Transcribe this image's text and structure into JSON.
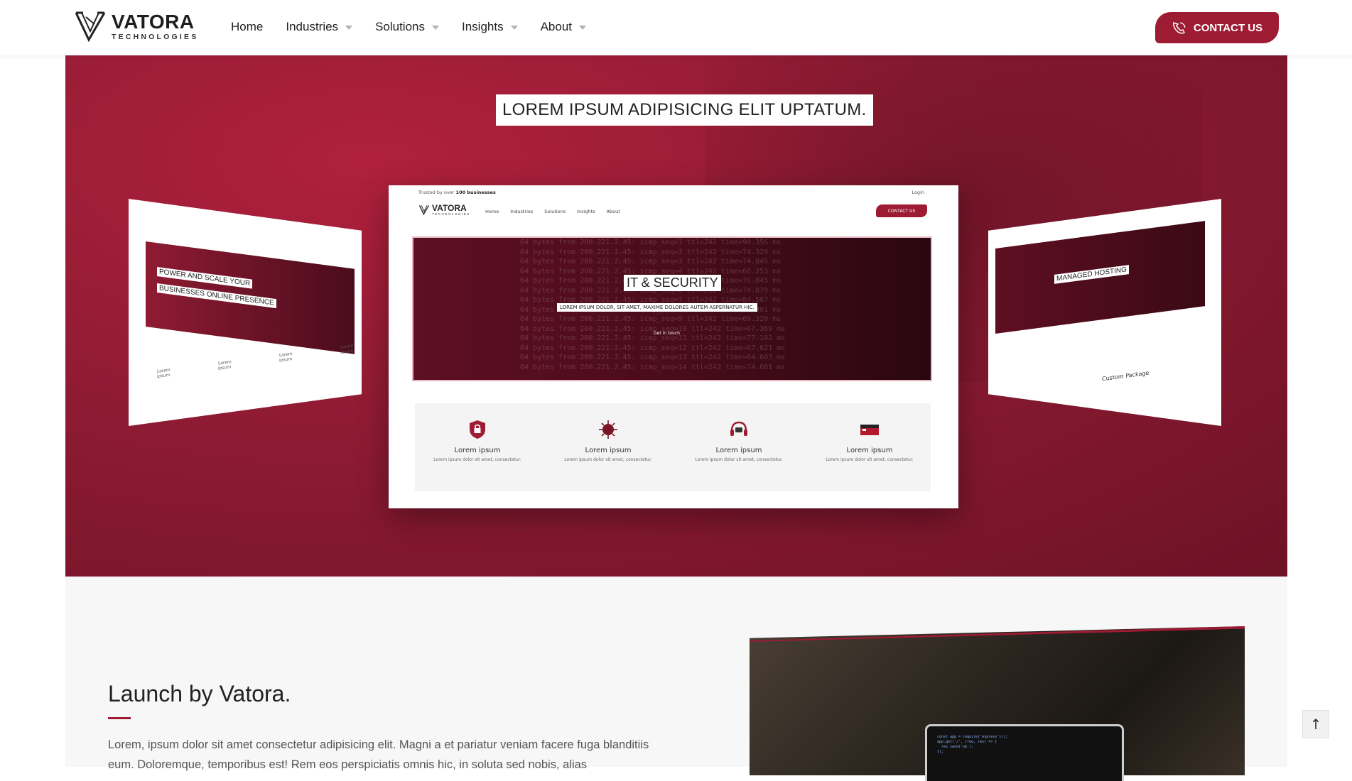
{
  "brand": {
    "name": "VATORA",
    "sub": "TECHNOLOGIES"
  },
  "nav": {
    "items": [
      {
        "label": "Home",
        "dropdown": false
      },
      {
        "label": "Industries",
        "dropdown": true
      },
      {
        "label": "Solutions",
        "dropdown": true
      },
      {
        "label": "Insights",
        "dropdown": true
      },
      {
        "label": "About",
        "dropdown": true
      }
    ],
    "contact_label": "CONTACT US"
  },
  "hero": {
    "title": "LOREM IPSUM ADIPISICING ELIT UPTATUM.",
    "center_mockup": {
      "trusted_prefix": "Trusted by over",
      "trusted_bold": "100 businesses",
      "login": "Login",
      "brand": "VATORA",
      "brand_sub": "TECHNOLOGIES",
      "menu": [
        "Home",
        "Industries",
        "Solutions",
        "Insights",
        "About"
      ],
      "contact": "CONTACT US",
      "banner_title": "IT & SECURITY",
      "banner_sub": "LOREM IPSUM DOLOR, SIT AMET, MAXIME DOLORES AUTEM ASPERNATUR HIC.",
      "banner_btn": "Get in touch",
      "features": [
        {
          "title": "Lorem ipsum",
          "desc": "Lorem ipsum dolor sit amet, consectetur.",
          "icon": "shield-lock-icon"
        },
        {
          "title": "Lorem ipsum",
          "desc": "Lorem ipsum dolor sit amet, consectetur.",
          "icon": "virus-icon"
        },
        {
          "title": "Lorem ipsum",
          "desc": "Lorem ipsum dolor sit amet, consectetur.",
          "icon": "headset-icon"
        },
        {
          "title": "Lorem ipsum",
          "desc": "Lorem ipsum dolor sit amet, consectetur.",
          "icon": "flag-icon"
        }
      ]
    },
    "left_mockup": {
      "title_line1": "POWER AND SCALE YOUR",
      "title_line2": "BUSINESSES ONLINE PRESENCE",
      "feature_labels": [
        "Lorem ipsum",
        "Lorem ipsum",
        "Lorem ipsum",
        "Lorem ipsum"
      ]
    },
    "right_mockup": {
      "title": "MANAGED HOSTING",
      "package": "Custom Package"
    }
  },
  "section": {
    "title": "Launch by Vatora.",
    "text": "Lorem, ipsum dolor sit amet consectetur adipisicing elit. Magni a et pariatur veniam facere fuga blanditiis eum. Doloremque, temporibus est! Rem eos perspiciatis omnis hic, in soluta sed nobis, alias"
  },
  "back_to_top": "↑",
  "colors": {
    "accent": "#9e1b34",
    "hero_dark": "#6d1226"
  }
}
